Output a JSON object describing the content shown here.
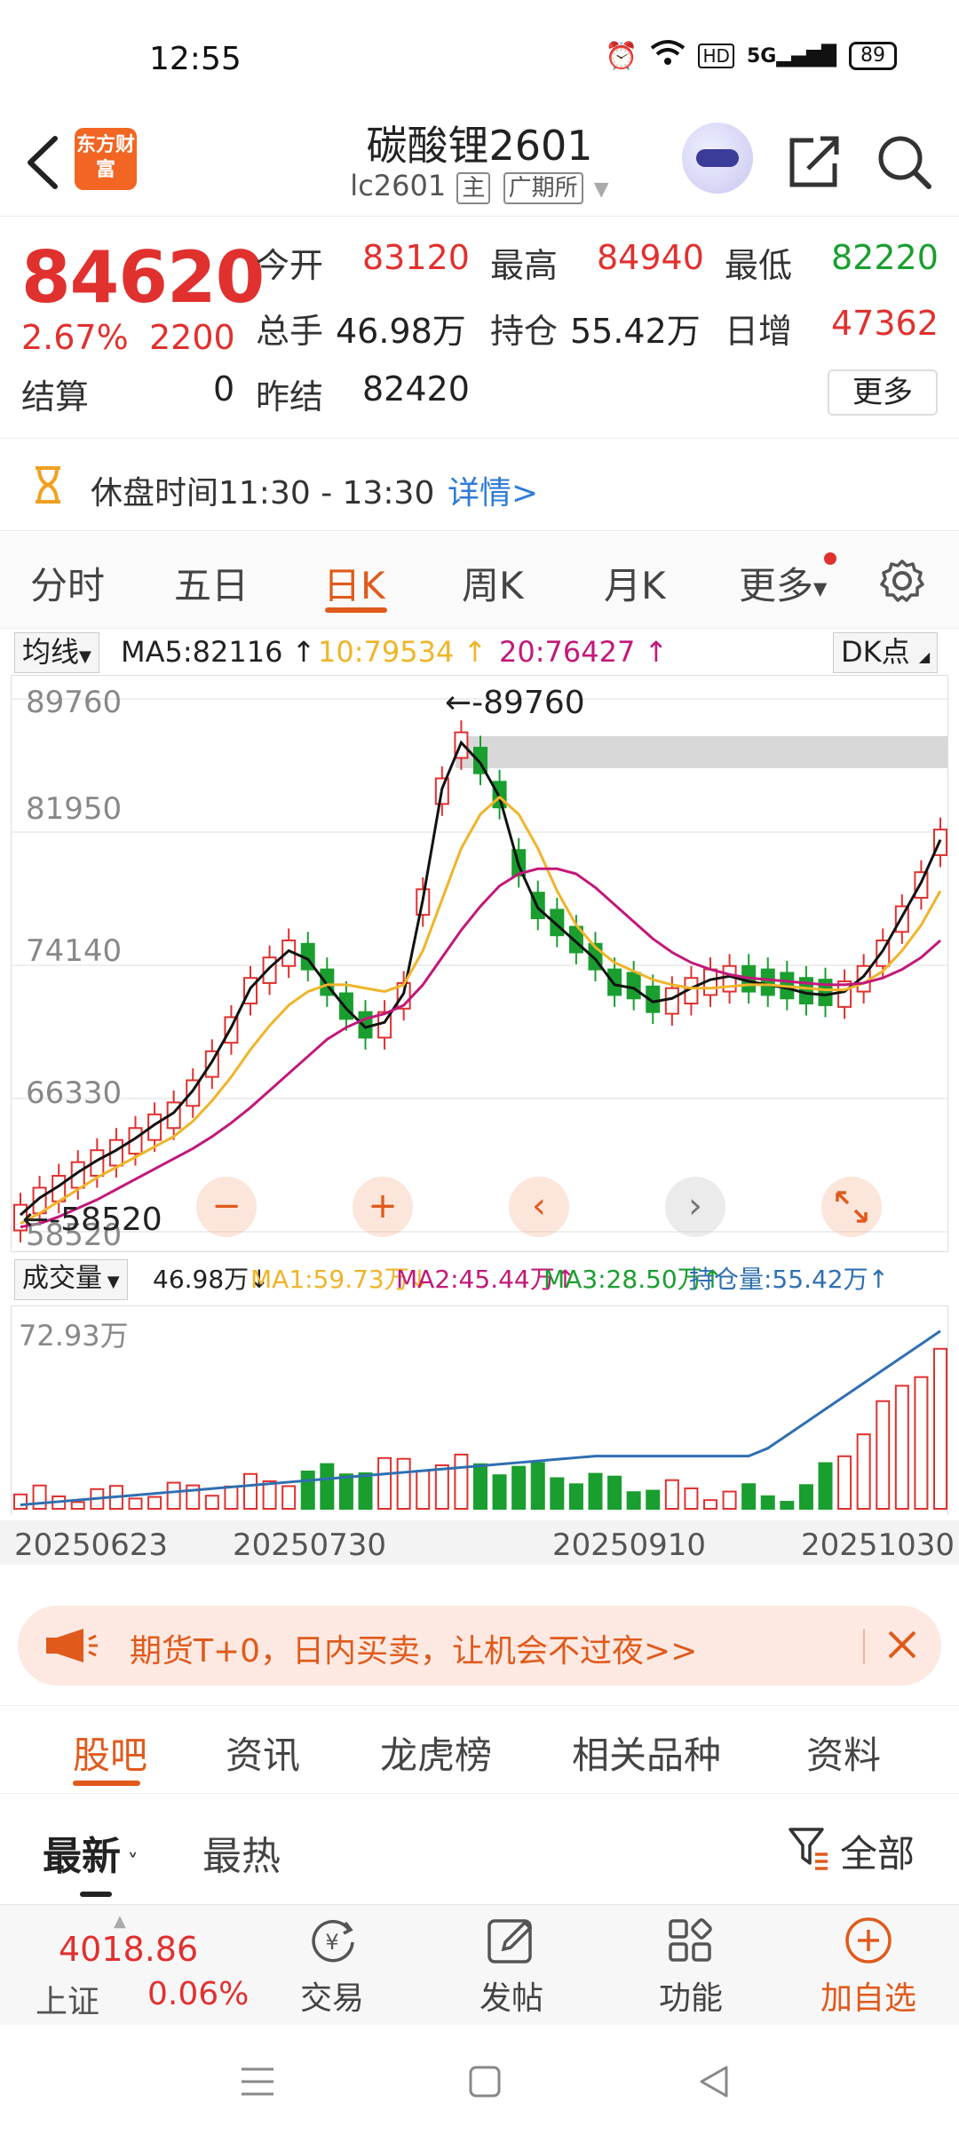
{
  "status": {
    "time": "12:55",
    "network": "5G",
    "hd": "HD",
    "battery": "89"
  },
  "header": {
    "logo_text": "东方财富",
    "title": "碳酸锂2601",
    "code": "lc2601",
    "tag_main": "主",
    "exchange": "广期所"
  },
  "quote": {
    "price": "84620",
    "change_pct": "2.67%",
    "change": "2200",
    "settle_label": "结算",
    "settle": "0",
    "open_label": "今开",
    "open": "83120",
    "high_label": "最高",
    "high": "84940",
    "low_label": "最低",
    "low": "82220",
    "volume_label": "总手",
    "volume": "46.98万",
    "oi_label": "持仓",
    "oi": "55.42万",
    "daily_inc_label": "日增",
    "daily_inc": "47362",
    "prev_settle_label": "昨结",
    "prev_settle": "82420",
    "more_label": "更多"
  },
  "notice": {
    "text": "休盘时间11:30 - 13:30",
    "link": "详情>"
  },
  "ktabs": [
    "分时",
    "五日",
    "日K",
    "周K",
    "月K",
    "更多"
  ],
  "ma_legend": {
    "selector": "均线",
    "ma5": "MA5:82116",
    "ma10": "10:79534",
    "ma20": "20:76427",
    "dk": "DK点"
  },
  "colors": {
    "up": "#e0312f",
    "down": "#1a9e2f",
    "ma5": "#111111",
    "ma10": "#f0b429",
    "ma20": "#c2187a",
    "oi": "#2f6fb0",
    "accent": "#e05a1c"
  },
  "chart_data": [
    {
      "type": "candlestick",
      "y_ticks": [
        "89760",
        "81950",
        "74140",
        "66330",
        "58520"
      ],
      "ylim": [
        58520,
        89760
      ],
      "annotations": {
        "max": "89760",
        "min": "58520"
      },
      "series": [
        {
          "name": "MA5",
          "values": [
            59500,
            60500,
            61200,
            62000,
            62700,
            63300,
            64000,
            64800,
            65500,
            66800,
            68500,
            70500,
            72800,
            74000,
            75000,
            74500,
            73000,
            71600,
            70500,
            70800,
            72500,
            78000,
            84500,
            87200,
            86000,
            84000,
            80000,
            77500,
            76500,
            75500,
            74500,
            73000,
            72800,
            72000,
            72200,
            72800,
            73300,
            73500,
            73200,
            73000,
            72800,
            72500,
            72400,
            72600,
            73500,
            75000,
            77000,
            79000,
            81500
          ]
        },
        {
          "name": "MA10",
          "values": [
            59000,
            59600,
            60300,
            61000,
            61700,
            62300,
            62900,
            63500,
            64100,
            65000,
            66200,
            67600,
            69200,
            70600,
            71800,
            72600,
            73000,
            73000,
            72800,
            72600,
            73000,
            75000,
            78000,
            81000,
            83000,
            84000,
            83000,
            81000,
            78500,
            76500,
            75200,
            74300,
            73800,
            73300,
            73000,
            72800,
            72800,
            72900,
            73000,
            73000,
            72900,
            72800,
            72700,
            72700,
            73100,
            73800,
            75000,
            76500,
            78500
          ]
        },
        {
          "name": "MA20",
          "values": [
            58800,
            59000,
            59400,
            59900,
            60400,
            61000,
            61600,
            62200,
            62800,
            63400,
            64100,
            64900,
            65800,
            66800,
            67800,
            68800,
            69800,
            70500,
            71000,
            71300,
            71800,
            73000,
            74600,
            76200,
            77600,
            78800,
            79500,
            79800,
            79800,
            79500,
            78700,
            77700,
            76700,
            75700,
            74900,
            74300,
            73900,
            73600,
            73400,
            73300,
            73200,
            73100,
            73000,
            73000,
            73100,
            73400,
            73900,
            74600,
            75600
          ]
        }
      ]
    },
    {
      "type": "bar",
      "y_ticks": [
        "72.93万"
      ],
      "legend": {
        "selector": "成交量",
        "vol": "46.98万",
        "ma1": "MA1:59.73万",
        "ma2": "MA2:45.44万",
        "ma3": "MA3:28.50万",
        "oi": "持仓量:55.42万"
      },
      "x_ticks": [
        "20250623",
        "20250730",
        "20250910",
        "20251030"
      ]
    }
  ],
  "controls": {
    "zoom_out": "−",
    "zoom_in": "+",
    "prev": "‹",
    "next": "›"
  },
  "promo": {
    "text": "期货T+0，日内买卖，让机会不过夜>>"
  },
  "subtabs": [
    "股吧",
    "资讯",
    "龙虎榜",
    "相关品种",
    "资料"
  ],
  "sort": {
    "latest": "最新",
    "hot": "最热",
    "filter": "全部"
  },
  "toolbar": {
    "index_value": "4018.86",
    "index_name": "上证",
    "index_pct": "0.06%",
    "trade": "交易",
    "post": "发帖",
    "features": "功能",
    "add_fav": "加自选"
  }
}
